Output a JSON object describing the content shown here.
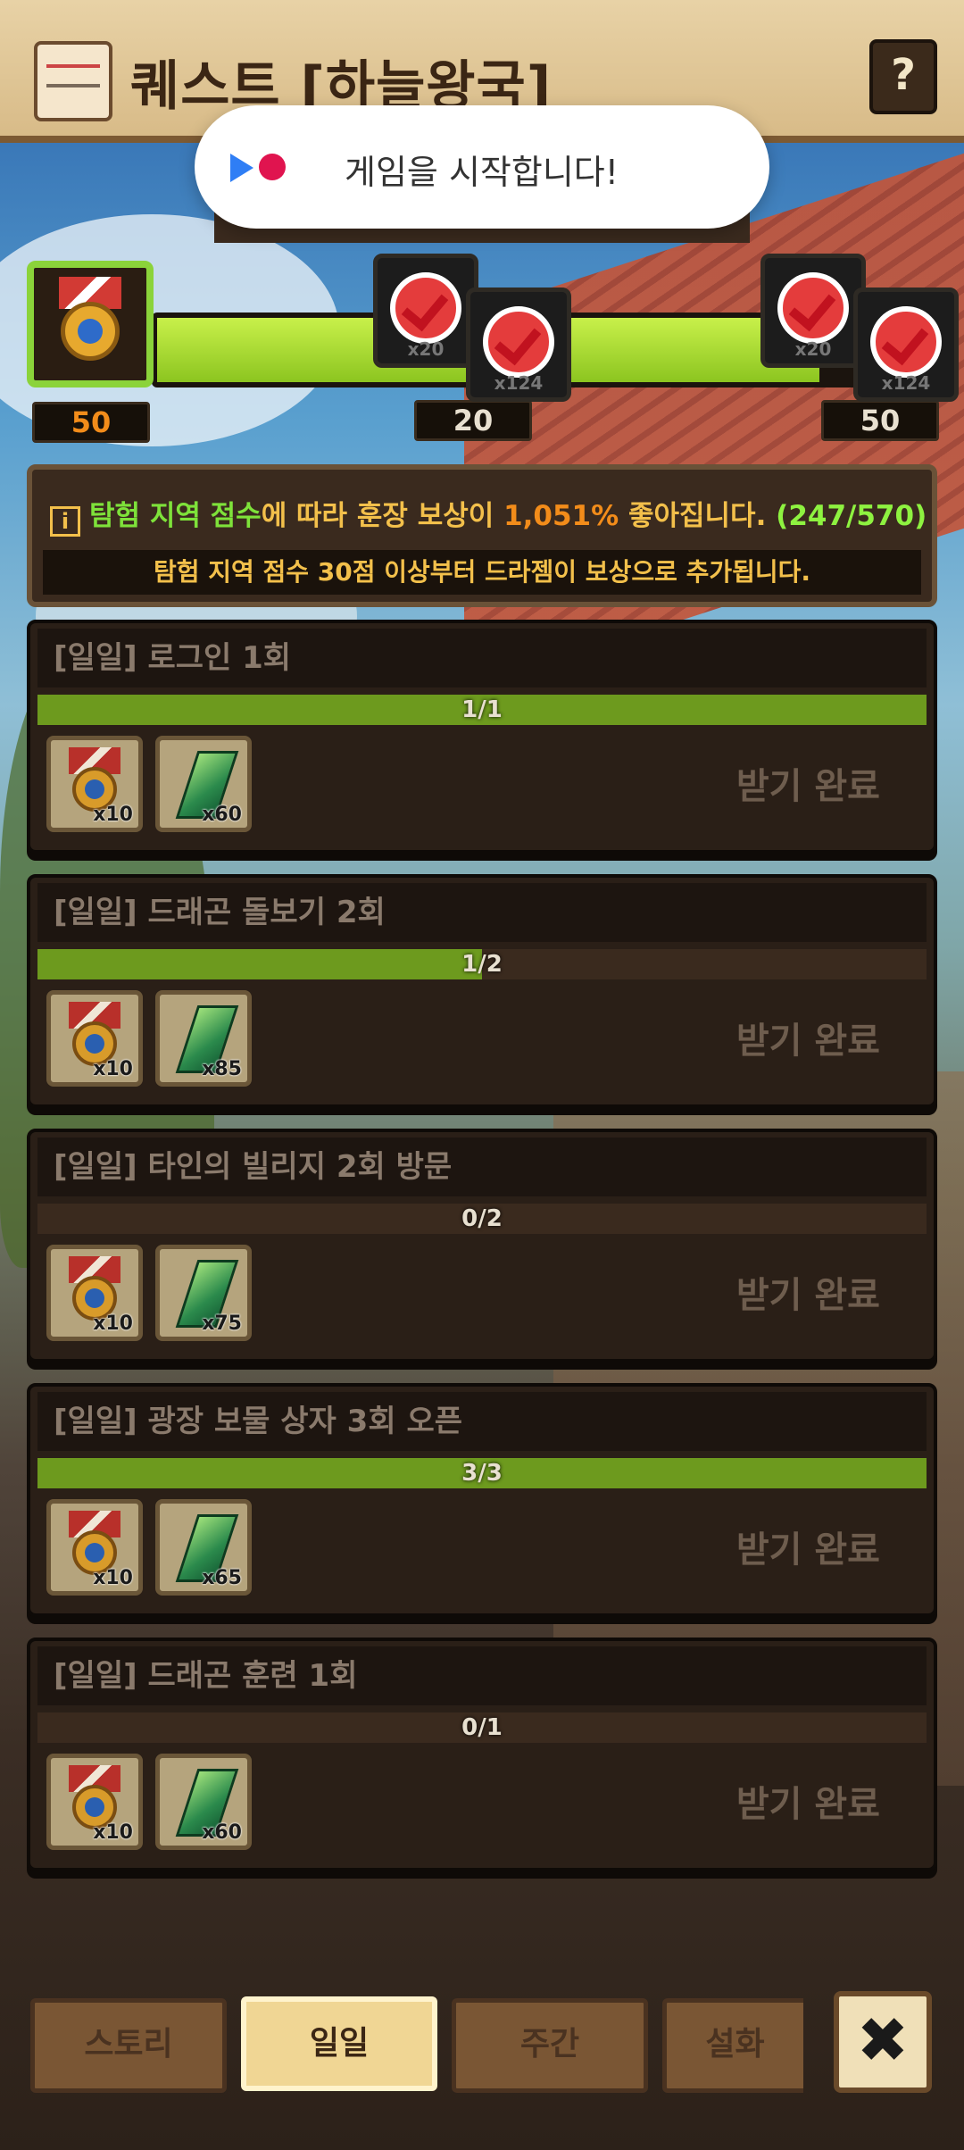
{
  "header": {
    "title": "퀘스트 [하늘왕국]",
    "help_label": "?"
  },
  "toast": {
    "message": "게임을 시작합니다!"
  },
  "progress": {
    "fill_fraction": 0.855,
    "start_score": "50",
    "milestones": [
      {
        "score": "20",
        "reward1_count": "x20",
        "reward2_count": "x124"
      },
      {
        "score": "50",
        "reward1_count": "x20",
        "reward2_count": "x124"
      }
    ]
  },
  "info": {
    "icon": "i",
    "part1": "탐험 지역 점수",
    "part2": "에 따라 훈장 보상이 ",
    "percent": "1,051%",
    "part3": " 좋아집니다. ",
    "ratio": "(247/570)",
    "subtext": "탐험 지역 점수 30점 이상부터 드라젬이 보상으로 추가됩니다."
  },
  "quests": [
    {
      "title": "[일일] 로그인 1회",
      "progress_text": "1/1",
      "progress_fraction": 1.0,
      "reward1": "x10",
      "reward2": "x60",
      "claim_label": "받기 완료"
    },
    {
      "title": "[일일] 드래곤 돌보기 2회",
      "progress_text": "1/2",
      "progress_fraction": 0.5,
      "reward1": "x10",
      "reward2": "x85",
      "claim_label": "받기 완료"
    },
    {
      "title": "[일일] 타인의 빌리지 2회 방문",
      "progress_text": "0/2",
      "progress_fraction": 0.0,
      "reward1": "x10",
      "reward2": "x75",
      "claim_label": "받기 완료"
    },
    {
      "title": "[일일] 광장 보물 상자 3회 오픈",
      "progress_text": "3/3",
      "progress_fraction": 1.0,
      "reward1": "x10",
      "reward2": "x65",
      "claim_label": "받기 완료"
    },
    {
      "title": "[일일] 드래곤 훈련 1회",
      "progress_text": "0/1",
      "progress_fraction": 0.0,
      "reward1": "x10",
      "reward2": "x60",
      "claim_label": "받기 완료"
    }
  ],
  "tabs": [
    {
      "label": "스토리",
      "active": false
    },
    {
      "label": "일일",
      "active": true
    },
    {
      "label": "주간",
      "active": false
    },
    {
      "label": "설화",
      "active": false
    }
  ],
  "close_label": "✖"
}
